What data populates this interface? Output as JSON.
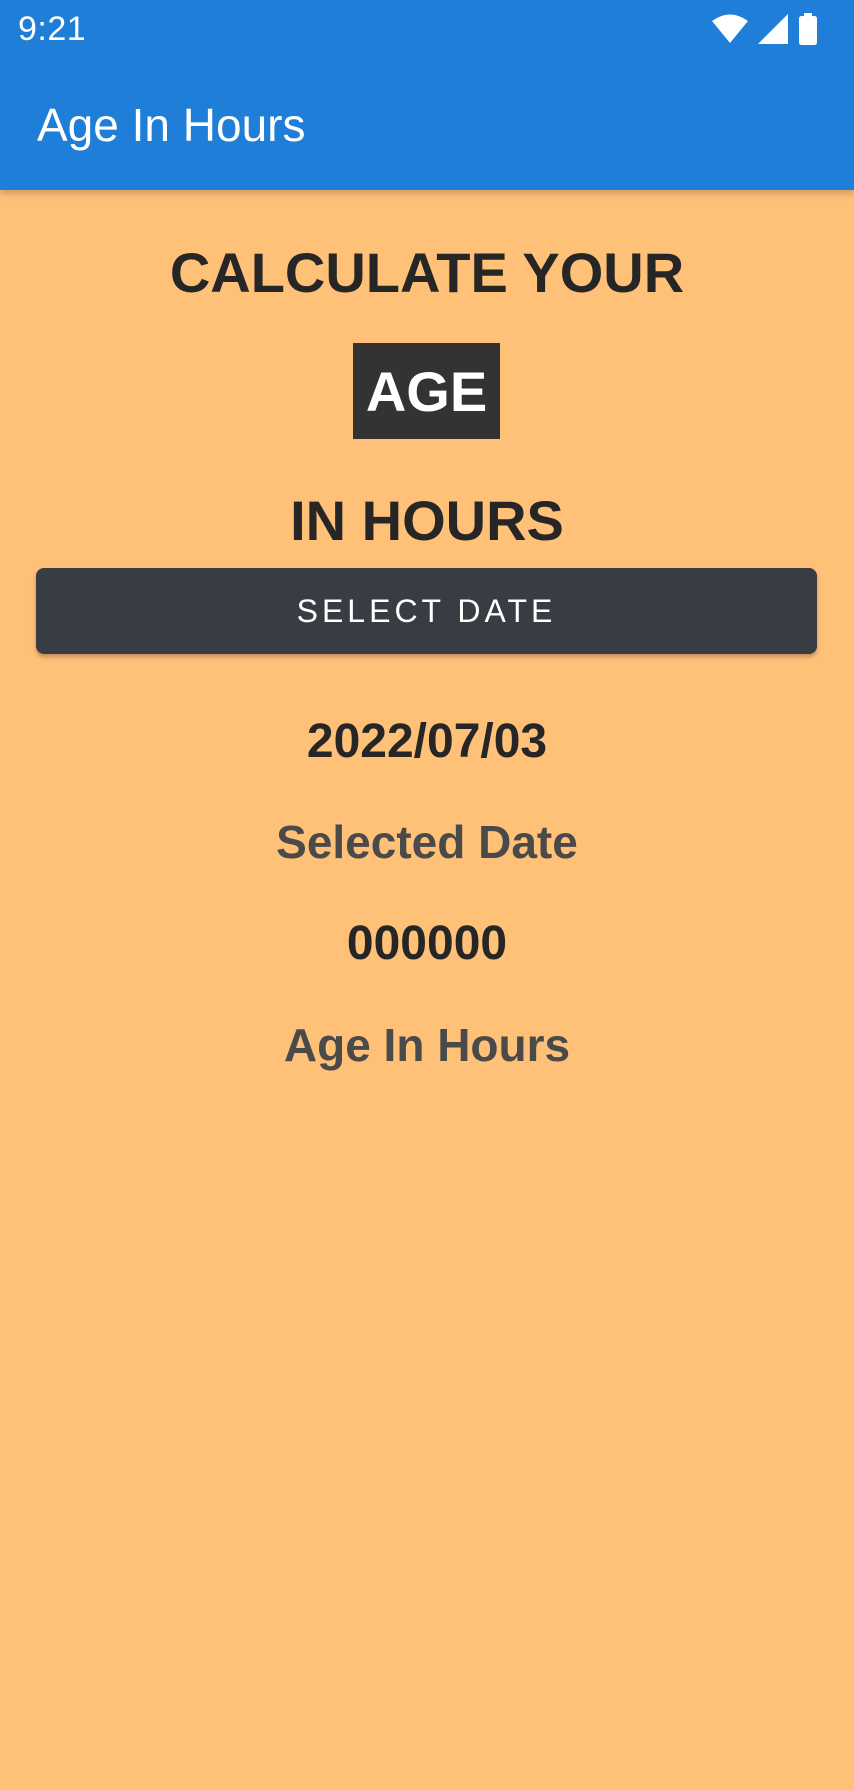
{
  "status_bar": {
    "time": "9:21",
    "icons": [
      "wifi-icon",
      "cell-signal-icon",
      "battery-icon"
    ]
  },
  "app_bar": {
    "title": "Age In Hours"
  },
  "content": {
    "heading_line1": "CALCULATE YOUR",
    "heading_age": "AGE",
    "heading_line3": "IN HOURS",
    "select_button_label": "SELECT DATE",
    "selected_date_value": "2022/07/03",
    "selected_date_label": "Selected Date",
    "age_hours_value": "000000",
    "age_hours_label": "Age In Hours"
  },
  "colors": {
    "app_bar": "#1f7ed8",
    "background": "#ffc078",
    "button": "#383c43",
    "age_box": "#333333",
    "heading_text": "#262626",
    "label_text": "#4a4a4a"
  }
}
